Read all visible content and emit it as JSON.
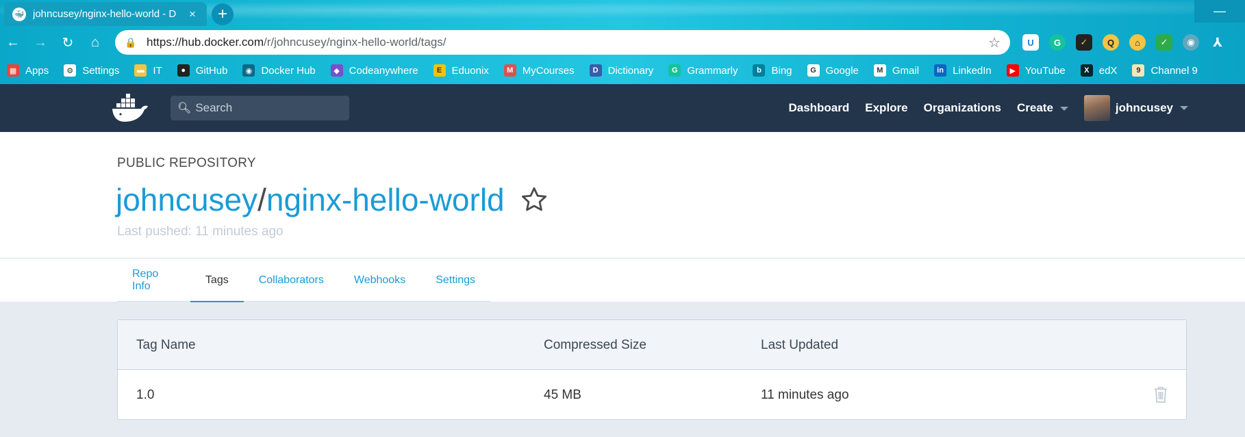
{
  "browser": {
    "tab_title": "johncusey/nginx-hello-world - D",
    "tab_close": "×",
    "new_tab": "+",
    "minimize": "—",
    "url_host": "https://hub.docker.com",
    "url_path": "/r/johncusey/nginx-hello-world/tags/",
    "bookmarks": [
      {
        "label": "Apps",
        "icon": "apps-grid-icon",
        "color": "#e8453c"
      },
      {
        "label": "Settings",
        "icon": "gear-icon",
        "color": "#ffffff"
      },
      {
        "label": "IT",
        "icon": "folder-icon",
        "color": "#f5c443"
      },
      {
        "label": "GitHub",
        "icon": "github-icon",
        "color": "#222222"
      },
      {
        "label": "Docker Hub",
        "icon": "docker-icon",
        "color": "#0b6a8c"
      },
      {
        "label": "Codeanywhere",
        "icon": "cube-icon",
        "color": "#7b4fc8"
      },
      {
        "label": "Eduonix",
        "icon": "eduonix-icon",
        "color": "#f2c300"
      },
      {
        "label": "MyCourses",
        "icon": "mycourses-icon",
        "color": "#d9534f"
      },
      {
        "label": "Dictionary",
        "icon": "dictionary-icon",
        "color": "#3a5ba9"
      },
      {
        "label": "Grammarly",
        "icon": "grammarly-icon",
        "color": "#15c39a"
      },
      {
        "label": "Bing",
        "icon": "bing-icon",
        "color": "#00809d"
      },
      {
        "label": "Google",
        "icon": "google-icon",
        "color": "#ffffff"
      },
      {
        "label": "Gmail",
        "icon": "gmail-icon",
        "color": "#ffffff"
      },
      {
        "label": "LinkedIn",
        "icon": "linkedin-icon",
        "color": "#0a66c2"
      },
      {
        "label": "YouTube",
        "icon": "youtube-icon",
        "color": "#ff0000"
      },
      {
        "label": "edX",
        "icon": "edx-icon",
        "color": "#02262b"
      },
      {
        "label": "Channel 9",
        "icon": "channel9-icon",
        "color": "#f5e6b8"
      }
    ]
  },
  "hub": {
    "search_placeholder": "Search",
    "nav": {
      "dashboard": "Dashboard",
      "explore": "Explore",
      "organizations": "Organizations",
      "create": "Create",
      "username": "johncusey"
    }
  },
  "repo": {
    "visibility": "PUBLIC REPOSITORY",
    "owner": "johncusey",
    "separator": "/",
    "name": "nginx-hello-world",
    "last_pushed": "Last pushed: 11 minutes ago",
    "tabs": [
      "Repo Info",
      "Tags",
      "Collaborators",
      "Webhooks",
      "Settings"
    ],
    "active_tab": "Tags"
  },
  "tags_table": {
    "headers": [
      "Tag Name",
      "Compressed Size",
      "Last Updated"
    ],
    "rows": [
      {
        "tag": "1.0",
        "size": "45 MB",
        "updated": "11 minutes ago"
      }
    ]
  },
  "colors": {
    "hub_nav_bg": "#22354b",
    "link_blue": "#1a9bd7",
    "page_bg": "#e6ebf1"
  }
}
